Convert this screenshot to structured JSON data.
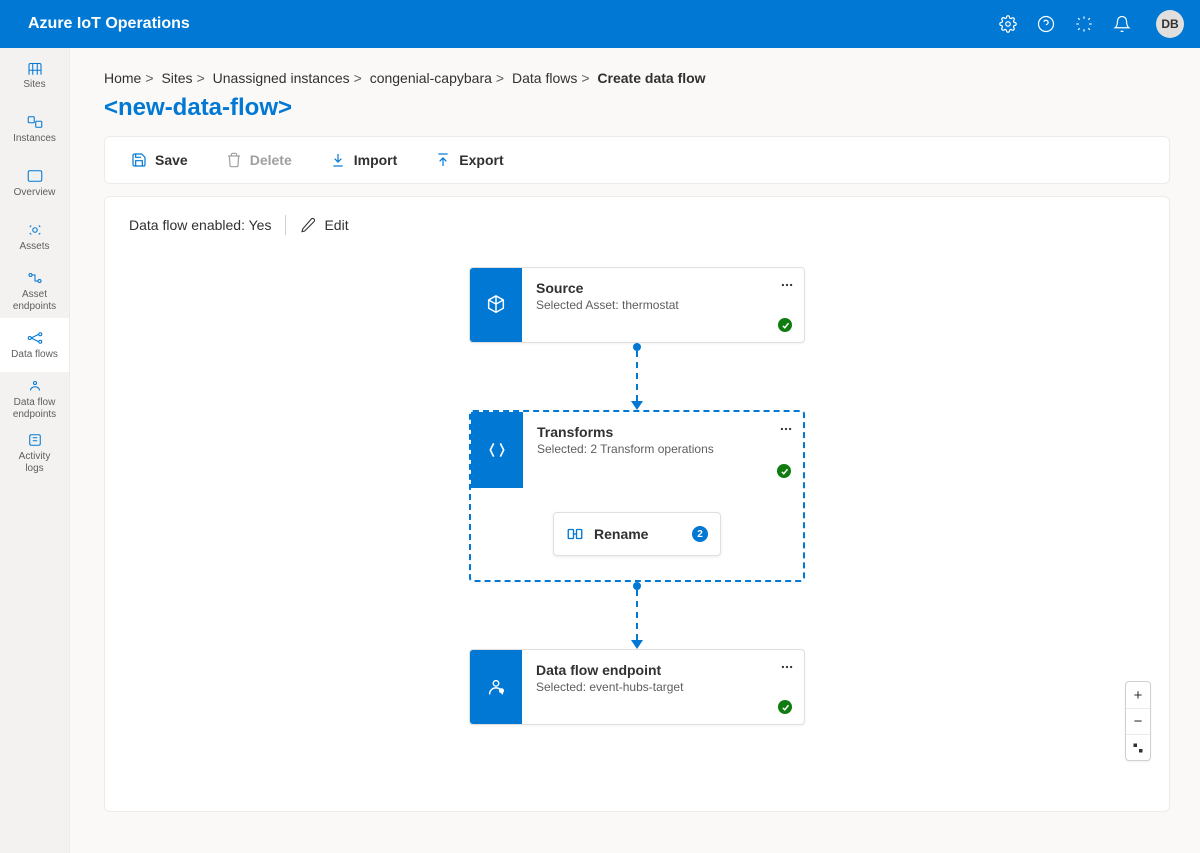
{
  "header": {
    "brand": "Azure IoT Operations",
    "avatar": "DB"
  },
  "sidebar": [
    {
      "label": "Sites"
    },
    {
      "label": "Instances"
    },
    {
      "label": "Overview"
    },
    {
      "label": "Assets"
    },
    {
      "label": "Asset\nendpoints"
    },
    {
      "label": "Data flows"
    },
    {
      "label": "Data flow\nendpoints"
    },
    {
      "label": "Activity\nlogs"
    }
  ],
  "breadcrumbs": {
    "items": [
      "Home",
      "Sites",
      "Unassigned instances",
      "congenial-capybara",
      "Data flows"
    ],
    "current": "Create data flow"
  },
  "page_title": "<new-data-flow>",
  "toolbar": {
    "save": "Save",
    "delete": "Delete",
    "import": "Import",
    "export": "Export"
  },
  "status": {
    "enabled_label": "Data flow enabled: Yes",
    "edit": "Edit"
  },
  "nodes": {
    "source": {
      "title": "Source",
      "subtitle": "Selected Asset: thermostat"
    },
    "transforms": {
      "title": "Transforms",
      "subtitle": "Selected: 2 Transform operations",
      "op_label": "Rename",
      "op_count": "2"
    },
    "endpoint": {
      "title": "Data flow endpoint",
      "subtitle": "Selected: event-hubs-target"
    }
  }
}
